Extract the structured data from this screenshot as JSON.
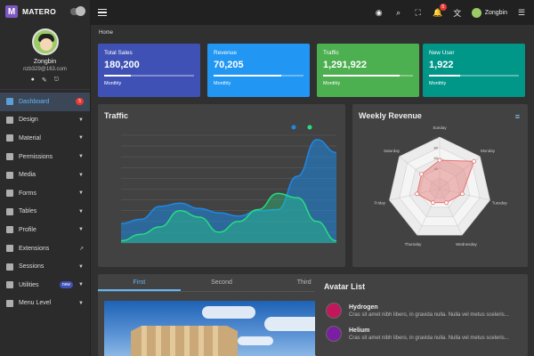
{
  "brand": {
    "name": "MATERO"
  },
  "user": {
    "name": "Zongbin",
    "email": "nzb329@163.com"
  },
  "nav": [
    {
      "label": "Dashboard",
      "badge": "5",
      "active": true
    },
    {
      "label": "Design"
    },
    {
      "label": "Material"
    },
    {
      "label": "Permissions"
    },
    {
      "label": "Media"
    },
    {
      "label": "Forms"
    },
    {
      "label": "Tables"
    },
    {
      "label": "Profile"
    },
    {
      "label": "Extensions"
    },
    {
      "label": "Sessions"
    },
    {
      "label": "Utilities",
      "badge": "new"
    },
    {
      "label": "Menu Level"
    }
  ],
  "topbar": {
    "notifications": "5",
    "user_name": "Zongbin"
  },
  "breadcrumb": "Home",
  "stats": [
    {
      "label": "Total Sales",
      "value": "180,200",
      "foot": "Monthly",
      "color": "#3f51b5",
      "progress": 0.3
    },
    {
      "label": "Revenue",
      "value": "70,205",
      "foot": "Monthly",
      "color": "#2196f3",
      "progress": 0.75
    },
    {
      "label": "Traffic",
      "value": "1,291,922",
      "foot": "Monthly",
      "color": "#4caf50",
      "progress": 0.85
    },
    {
      "label": "New User",
      "value": "1,922",
      "foot": "Monthly",
      "color": "#009688",
      "progress": 0.35
    }
  ],
  "traffic": {
    "title": "Traffic"
  },
  "weekly": {
    "title": "Weekly Revenue",
    "days": [
      "Sunday",
      "Monday",
      "Tuesday",
      "Wednesday",
      "Thursday",
      "Friday",
      "Saturday"
    ],
    "ticks": [
      "100",
      "80",
      "60",
      "40"
    ]
  },
  "tabs": [
    "First",
    "Second",
    "Third"
  ],
  "avatar_list": {
    "title": "Avatar List",
    "items": [
      {
        "name": "Hydrogen",
        "text": "Cras sit amet nibh libero, in gravida nulla. Nulla vel metus sceleris..."
      },
      {
        "name": "Helium",
        "text": "Cras sit amet nibh libero, in gravida nulla. Nulla vel metus sceleris..."
      }
    ]
  },
  "chart_data": [
    {
      "type": "area",
      "title": "Traffic",
      "series": [
        {
          "color": "#1e88e5",
          "values": [
            18,
            22,
            34,
            37,
            32,
            28,
            25,
            30,
            31,
            62,
            96,
            84
          ]
        },
        {
          "color": "#26de81",
          "values": [
            2,
            8,
            15,
            30,
            24,
            10,
            20,
            31,
            46,
            42,
            20,
            2
          ]
        }
      ],
      "ylim": [
        0,
        100
      ],
      "grid": true
    },
    {
      "type": "radar",
      "title": "Weekly Revenue",
      "categories": [
        "Sunday",
        "Monday",
        "Tuesday",
        "Wednesday",
        "Thursday",
        "Friday",
        "Saturday"
      ],
      "values": [
        55,
        85,
        45,
        30,
        30,
        45,
        45
      ],
      "color": "#e57373"
    }
  ]
}
